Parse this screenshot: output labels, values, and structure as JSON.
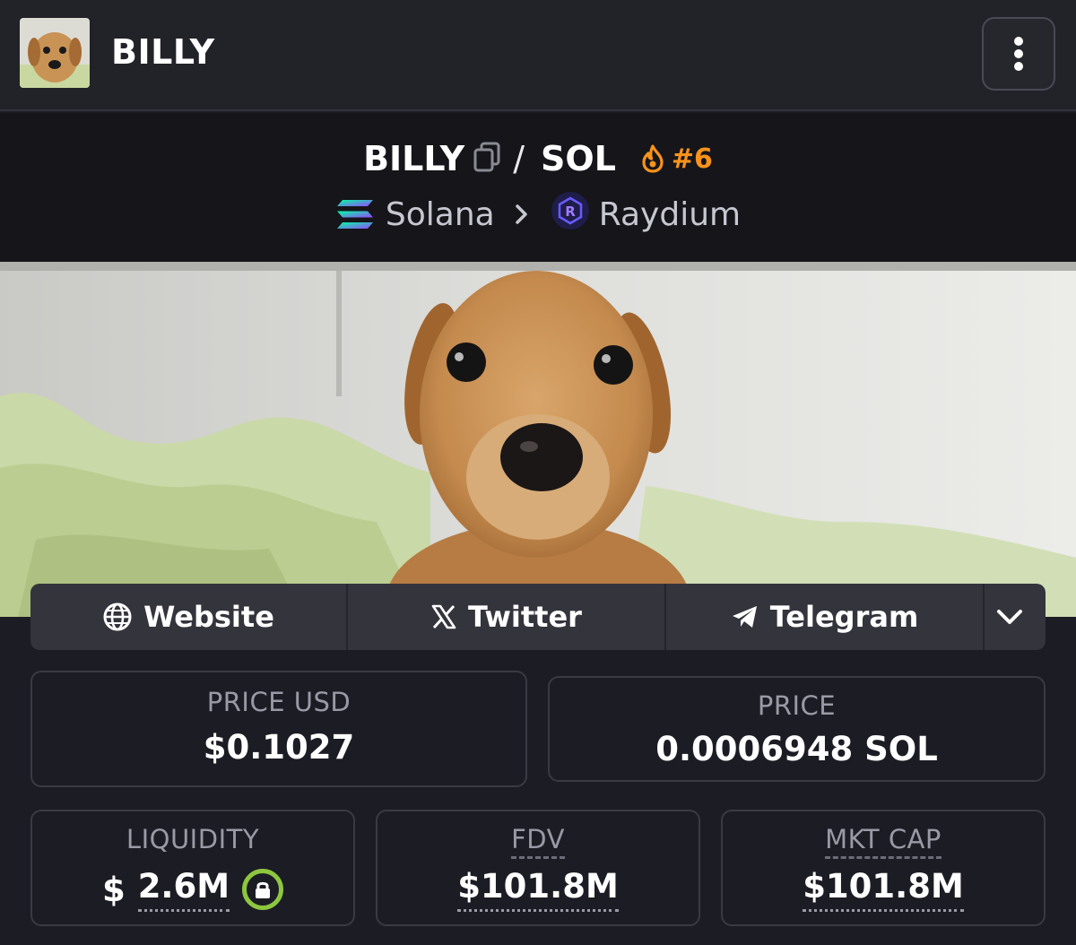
{
  "header": {
    "title": "BILLY",
    "menu_icon": "kebab-menu-icon"
  },
  "pair": {
    "base": "BILLY",
    "separator": "/",
    "quote": "SOL",
    "rank": "#6",
    "rank_color": "#f7931a",
    "chain": "Solana",
    "dex": "Raydium"
  },
  "links": {
    "website": "Website",
    "twitter": "Twitter",
    "telegram": "Telegram"
  },
  "stats": {
    "price_usd": {
      "label": "PRICE USD",
      "value": "$0.1027"
    },
    "price": {
      "label": "PRICE",
      "value": "0.0006948 SOL"
    },
    "liquidity": {
      "label": "LIQUIDITY",
      "currency": "$",
      "value": "2.6M"
    },
    "fdv": {
      "label": "FDV",
      "value": "$101.8M"
    },
    "mkt_cap": {
      "label": "MKT CAP",
      "value": "$101.8M"
    }
  },
  "colors": {
    "background": "#1c1c24",
    "header_bg": "#222229",
    "pair_bg": "#15151a",
    "lock_green": "#8dc63f",
    "solana_gradient": [
      "#00ffa3",
      "#9945ff"
    ]
  }
}
